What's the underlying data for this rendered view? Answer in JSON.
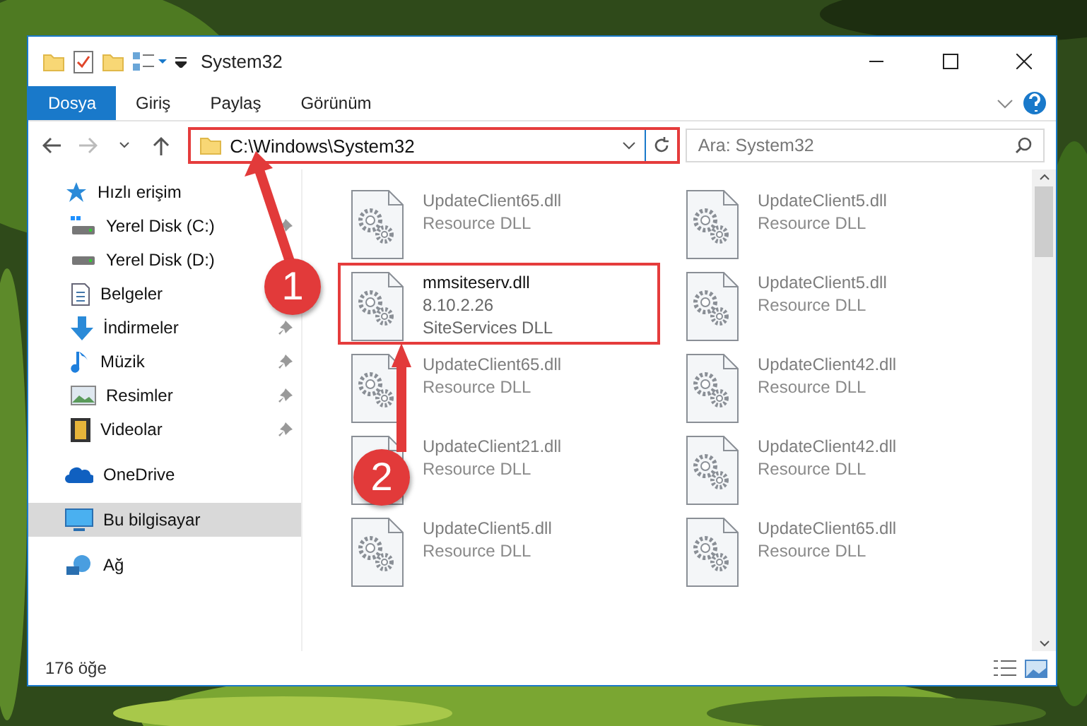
{
  "window": {
    "title": "System32"
  },
  "ribbon_tabs": [
    {
      "label": "Dosya",
      "kind": "file"
    },
    {
      "label": "Giriş",
      "kind": "tab"
    },
    {
      "label": "Paylaş",
      "kind": "tab"
    },
    {
      "label": "Görünüm",
      "kind": "tab"
    }
  ],
  "address_bar": {
    "path": "C:\\Windows\\System32",
    "highlighted": true
  },
  "search": {
    "placeholder": "Ara: System32"
  },
  "sidebar": {
    "items": [
      {
        "label": "Hızlı erişim",
        "selected": false,
        "children": [
          {
            "label": "Yerel Disk (C:)",
            "pinned": true,
            "selected": false
          },
          {
            "label": "Yerel Disk (D:)",
            "pinned": false,
            "selected": false
          },
          {
            "label": "Belgeler",
            "pinned": false,
            "selected": false
          },
          {
            "label": "İndirmeler",
            "pinned": true,
            "selected": false
          },
          {
            "label": "Müzik",
            "pinned": true,
            "selected": false
          },
          {
            "label": "Resimler",
            "pinned": true,
            "selected": false
          },
          {
            "label": "Videolar",
            "pinned": true,
            "selected": false
          }
        ]
      },
      {
        "label": "OneDrive",
        "selected": false
      },
      {
        "label": "Bu bilgisayar",
        "selected": true
      },
      {
        "label": "Ağ",
        "selected": false
      }
    ]
  },
  "files": [
    {
      "name": "UpdateClient65.dll",
      "lines": [
        "Resource DLL"
      ],
      "highlighted": false
    },
    {
      "name": "UpdateClient5.dll",
      "lines": [
        "Resource DLL"
      ],
      "highlighted": false
    },
    {
      "name": "mmsiteserv.dll",
      "lines": [
        "8.10.2.26",
        "SiteServices DLL"
      ],
      "highlighted": true
    },
    {
      "name": "UpdateClient5.dll",
      "lines": [
        "Resource DLL"
      ],
      "highlighted": false
    },
    {
      "name": "UpdateClient65.dll",
      "lines": [
        "Resource DLL"
      ],
      "highlighted": false
    },
    {
      "name": "UpdateClient42.dll",
      "lines": [
        "Resource DLL"
      ],
      "highlighted": false
    },
    {
      "name": "UpdateClient21.dll",
      "lines": [
        "Resource DLL"
      ],
      "highlighted": false
    },
    {
      "name": "UpdateClient42.dll",
      "lines": [
        "Resource DLL"
      ],
      "highlighted": false
    },
    {
      "name": "UpdateClient5.dll",
      "lines": [
        "Resource DLL"
      ],
      "highlighted": false
    },
    {
      "name": "UpdateClient65.dll",
      "lines": [
        "Resource DLL"
      ],
      "highlighted": false
    }
  ],
  "status_bar": {
    "count": "176 öğe"
  },
  "annotations": [
    {
      "number": "1"
    },
    {
      "number": "2"
    }
  ]
}
